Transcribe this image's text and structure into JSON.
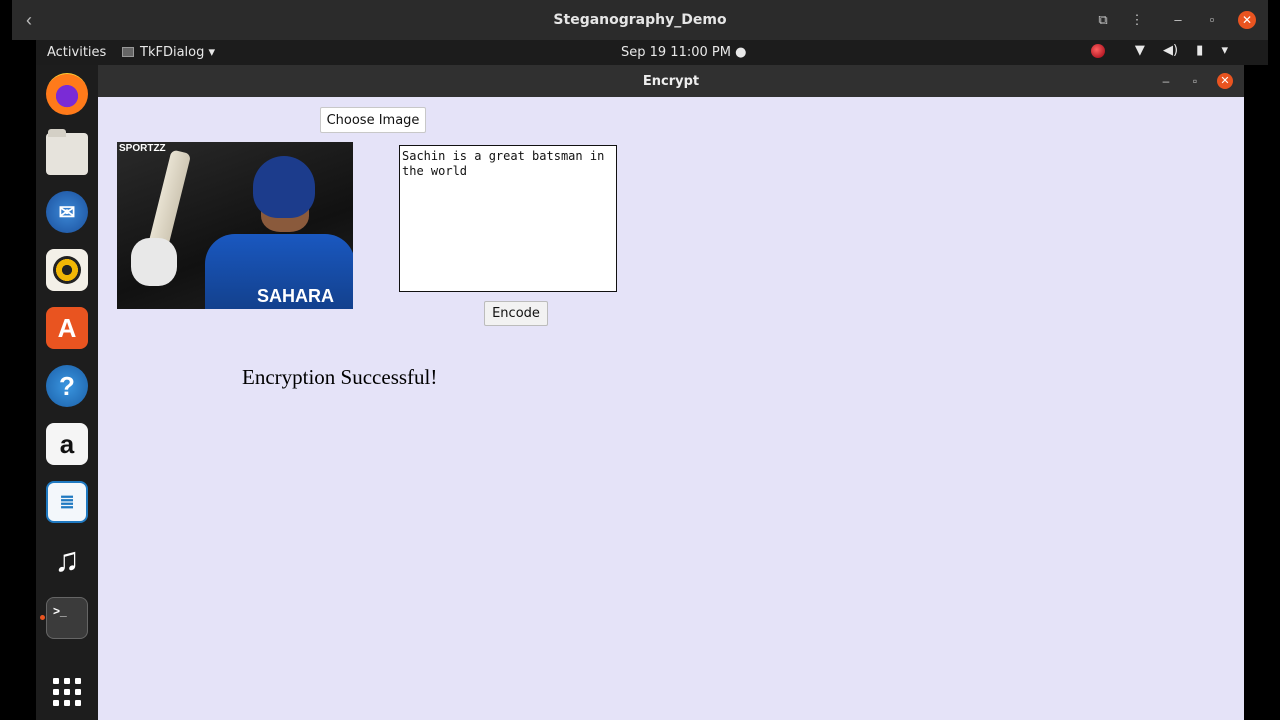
{
  "outer_window": {
    "title": "Steganography_Demo"
  },
  "topbar": {
    "activities": "Activities",
    "app_menu": "TkFDialog ▾",
    "clock": "Sep 19  11:00 PM ●"
  },
  "dock": {
    "items": [
      "firefox",
      "files",
      "thunderbird",
      "rhythmbox",
      "ubuntu-software",
      "help",
      "amazon",
      "libreoffice-writer",
      "music",
      "terminal",
      "show-applications"
    ]
  },
  "encrypt_window": {
    "title": "Encrypt",
    "choose_image_label": "Choose Image",
    "image": {
      "logo_text": "SPORTZZ",
      "shirt_text": "SAHARA"
    },
    "message_text": "Sachin is a great batsman in the world",
    "encode_label": "Encode",
    "status_text": "Encryption Successful!"
  },
  "colors": {
    "window_bg": "#e5e3f8",
    "accent_close": "#e95420"
  }
}
